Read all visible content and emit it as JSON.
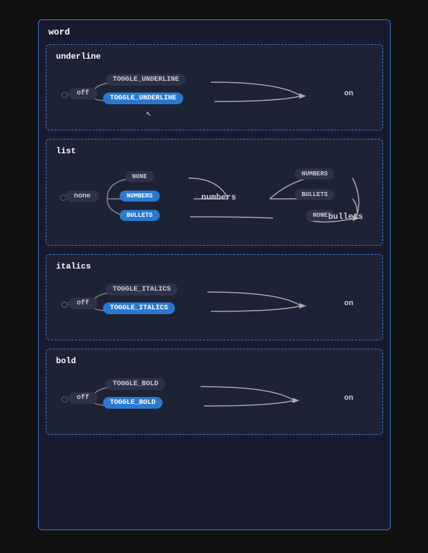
{
  "outer": {
    "title": "word",
    "border_color": "#3a7bd5"
  },
  "sections": [
    {
      "id": "underline",
      "title": "underline",
      "type": "toggle",
      "nodes": {
        "left_label": "off",
        "right_label": "on",
        "toggle_top": "TOGGLE_UNDERLINE",
        "toggle_bot": "TOGGLE_UNDERLINE"
      }
    },
    {
      "id": "list",
      "title": "list",
      "type": "multi",
      "nodes": {
        "left_label": "none",
        "middle_label": "numbers",
        "right_label": "bullets",
        "options_left": [
          "NONE",
          "NUMBERS",
          "BULLETS"
        ],
        "options_right": [
          "NUMBERS",
          "BULLETS",
          "NONE"
        ]
      }
    },
    {
      "id": "italics",
      "title": "italics",
      "type": "toggle",
      "nodes": {
        "left_label": "off",
        "right_label": "on",
        "toggle_top": "TOGGLE_ITALICS",
        "toggle_bot": "TOGGLE_ITALICS"
      }
    },
    {
      "id": "bold",
      "title": "bold",
      "type": "toggle",
      "nodes": {
        "left_label": "off",
        "right_label": "on",
        "toggle_top": "TOGGLE_BOLD",
        "toggle_bot": "TOGGLE_BOLD"
      }
    }
  ]
}
